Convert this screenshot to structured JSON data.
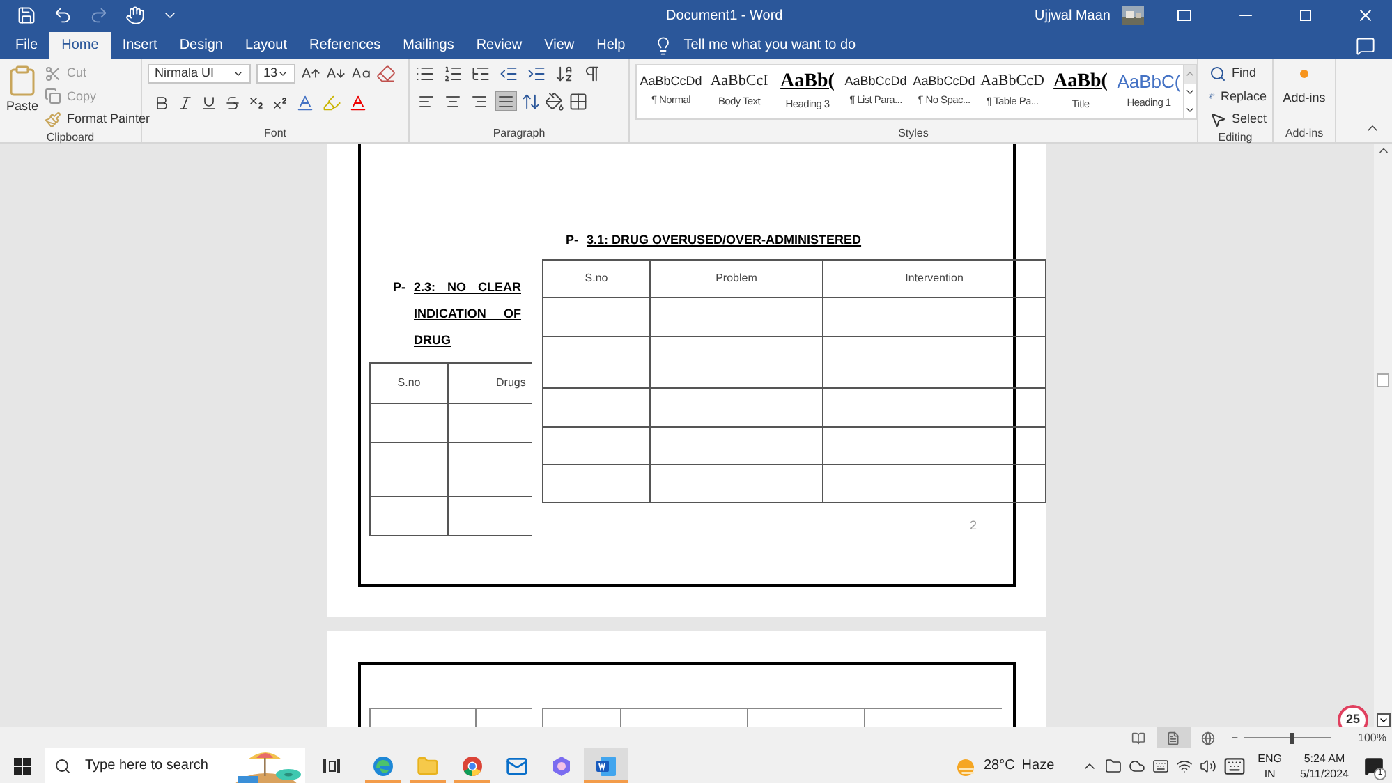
{
  "window": {
    "title": "Document1  -  Word",
    "user": "Ujjwal Maan"
  },
  "ribbon_tabs": [
    {
      "label": "File",
      "selected": false
    },
    {
      "label": "Home",
      "selected": true
    },
    {
      "label": "Insert",
      "selected": false
    },
    {
      "label": "Design",
      "selected": false
    },
    {
      "label": "Layout",
      "selected": false
    },
    {
      "label": "References",
      "selected": false
    },
    {
      "label": "Mailings",
      "selected": false
    },
    {
      "label": "Review",
      "selected": false
    },
    {
      "label": "View",
      "selected": false
    },
    {
      "label": "Help",
      "selected": false
    }
  ],
  "tell_me": "Tell me what you want to do",
  "clipboard": {
    "paste": "Paste",
    "cut": "Cut",
    "copy": "Copy",
    "format_painter": "Format Painter",
    "label": "Clipboard"
  },
  "font": {
    "name": "Nirmala UI",
    "size": "13",
    "label": "Font"
  },
  "paragraph": {
    "label": "Paragraph",
    "alignment": [
      {
        "kind": "left",
        "selected": false
      },
      {
        "kind": "center",
        "selected": false
      },
      {
        "kind": "right",
        "selected": false
      },
      {
        "kind": "justify",
        "selected": true
      }
    ]
  },
  "styles": {
    "label": "Styles",
    "items": [
      {
        "preview": "AaBbCcDd",
        "name": "¶ Normal",
        "kind": "plain"
      },
      {
        "preview": "AaBbCcI",
        "name": "Body Text",
        "kind": "serif"
      },
      {
        "preview": "AaBb(",
        "name": "Heading 3",
        "kind": "heading"
      },
      {
        "preview": "AaBbCcDd",
        "name": "¶ List Para...",
        "kind": "plain"
      },
      {
        "preview": "AaBbCcDd",
        "name": "¶ No Spac...",
        "kind": "plain"
      },
      {
        "preview": "AaBbCcD",
        "name": "¶ Table Pa...",
        "kind": "serif"
      },
      {
        "preview": "AaBb(",
        "name": "Title",
        "kind": "heading"
      },
      {
        "preview": "AaBbC(",
        "name": "Heading 1",
        "kind": "accent"
      }
    ]
  },
  "editing": {
    "label": "Editing",
    "find": "Find",
    "replace": "Replace",
    "select": "Select"
  },
  "addins": {
    "button": "Add-ins",
    "label": "Add-ins"
  },
  "document": {
    "left_heading": {
      "prefix": "P-",
      "title": "2.3: NO CLEAR INDICATION OF DRUG"
    },
    "left_table": {
      "columns": [
        "S.no",
        "Drugs"
      ]
    },
    "right_heading": {
      "prefix": "P-",
      "title": "3.1: DRUG OVERUSED/OVER-ADMINISTERED"
    },
    "right_table": {
      "columns": [
        "S.no",
        "Problem",
        "Intervention"
      ]
    },
    "page_number": "2"
  },
  "status_bar": {
    "views": [
      {
        "kind": "read",
        "selected": false
      },
      {
        "kind": "print",
        "selected": true
      },
      {
        "kind": "web",
        "selected": false
      }
    ],
    "zoom": {
      "zoom_out": "−",
      "level": 0.55,
      "reading": "100%"
    }
  },
  "badge": "25",
  "taskbar": {
    "search_placeholder": "Type here to search",
    "apps": [
      {
        "kind": "edge",
        "running": true,
        "selected": false
      },
      {
        "kind": "explorer",
        "running": true,
        "selected": false
      },
      {
        "kind": "chrome",
        "running": true,
        "selected": false
      },
      {
        "kind": "mail",
        "running": false,
        "selected": false
      },
      {
        "kind": "copilot",
        "running": false,
        "selected": false
      },
      {
        "kind": "word",
        "running": true,
        "selected": true
      }
    ],
    "weather": {
      "temperature": "28°C",
      "condition": "Haze"
    },
    "language": {
      "line1": "ENG",
      "line2": "IN"
    },
    "time": "5:24 AM",
    "date": "5/11/2024",
    "notifications": "1"
  }
}
